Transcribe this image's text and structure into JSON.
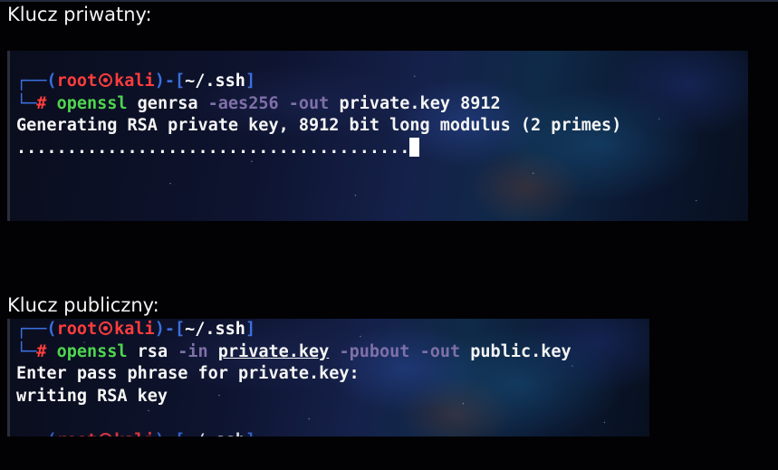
{
  "headings": {
    "private_key": "Klucz priwatny:",
    "public_key": "Klucz publiczny:"
  },
  "prompt": {
    "open": "┌──(",
    "user": "root",
    "host": "kali",
    "mid": ")-[",
    "path": "~/.ssh",
    "close": "]",
    "corner": "└─",
    "hash": "#",
    "skull_icon": "kali-skull-icon"
  },
  "terminal_private": {
    "command": {
      "program": "openssl",
      "subcommand": "genrsa",
      "flag1": "-aes256",
      "flag2": "-out",
      "file": "private.key",
      "bits": "8912"
    },
    "output": [
      "Generating RSA private key, 8912 bit long modulus (2 primes)",
      "......................................."
    ]
  },
  "terminal_public": {
    "command": {
      "program": "openssl",
      "subcommand": "rsa",
      "flag1": "-in",
      "infile": "private.key",
      "flag2": "-pubout",
      "flag3": "-out",
      "outfile": "public.key"
    },
    "output": [
      "Enter pass phrase for private.key:",
      "writing RSA key"
    ]
  },
  "colors": {
    "background": "#020204",
    "prompt_frame": "#3b6fe0",
    "prompt_user": "#ff3d3d",
    "command": "#4fd64f",
    "flags": "#7f70a8",
    "text": "#f5f5f5"
  }
}
